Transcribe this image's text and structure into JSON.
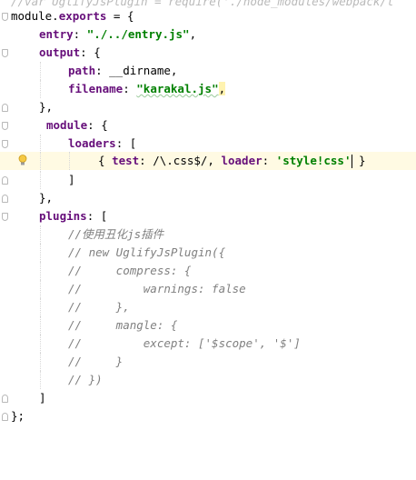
{
  "lines": [
    {
      "t1": "//var UglifyJsPlugin = require('./node_modules/webpack/l"
    },
    {
      "t1": "module",
      "t2": ".",
      "t3": "exports",
      "t4": " = {"
    },
    {
      "t1": "entry",
      "t2": ": ",
      "t3": "\"./../entry.js\"",
      "t4": ","
    },
    {
      "t1": "output",
      "t2": ": {"
    },
    {
      "t1": "path",
      "t2": ": __dirname,"
    },
    {
      "t1": "filename",
      "t2": ": ",
      "t3": "\"karakal.js\"",
      "t4": ","
    },
    {
      "t1": "},"
    },
    {
      "t1": "module",
      "t2": ": {"
    },
    {
      "t1": "loaders",
      "t2": ": ["
    },
    {
      "t1": "{ ",
      "t2": "test",
      "t3": ": /\\.css$/, ",
      "t4": "loader",
      "t5": ": ",
      "t6": "'style!css'",
      "t7": " }"
    },
    {
      "t1": "]"
    },
    {
      "t1": "},"
    },
    {
      "t1": "plugins",
      "t2": ": ["
    },
    {
      "t1": "//使用丑化js插件"
    },
    {
      "t1": "// new UglifyJsPlugin({"
    },
    {
      "t1": "//     compress: {"
    },
    {
      "t1": "//         warnings: false"
    },
    {
      "t1": "//     },"
    },
    {
      "t1": "//     mangle: {"
    },
    {
      "t1": "//         except: ['$scope', '$']"
    },
    {
      "t1": "//     }"
    },
    {
      "t1": "// })"
    },
    {
      "t1": "]"
    },
    {
      "t1": "};"
    }
  ]
}
